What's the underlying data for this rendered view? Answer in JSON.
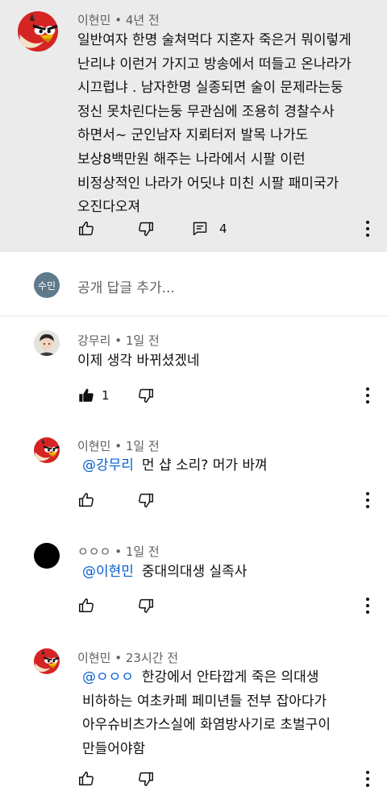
{
  "comment": {
    "author": "이현민",
    "time": "4년 전",
    "lines": [
      "일반여자 한명 술쳐먹다 지혼자 죽은거 뭐이렇게",
      "난리냐 이런거 가지고 방송에서 떠들고 온나라가",
      "시끄럽냐 . 남자한명 실종되면 술이 문제라는둥",
      "정신 못차린다는둥 무관심에 조용히 경찰수사",
      "하면서~ 군인남자 지뢰터저 발목 나가도",
      "보상8백만원 해주는 나라에서 시팔 이런",
      "비정상적인 나라가 어딧냐 미친 시팔 패미국가",
      "오진다오져"
    ],
    "reply_count": "4"
  },
  "reply_box": {
    "avatar_label": "수민",
    "placeholder": "공개 답글 추가..."
  },
  "replies": [
    {
      "author": "강무리",
      "time": "1일 전",
      "mention": "",
      "lines": [
        "이제 생각 바뀌셨겠네"
      ],
      "likes": "1"
    },
    {
      "author": "이현민",
      "time": "1일 전",
      "mention": "@강무리",
      "lines": [
        "먼 샵 소리? 머가 바껴"
      ],
      "likes": ""
    },
    {
      "author": "ㅇㅇㅇ",
      "time": "1일 전",
      "mention": "@이현민",
      "lines": [
        "중대의대생 실족사"
      ],
      "likes": ""
    },
    {
      "author": "이현민",
      "time": "23시간 전",
      "mention": "@ㅇㅇㅇ",
      "lines": [
        "한강에서 안타깝게 죽은 의대생",
        "비하하는 여초카페 페미년들 전부 잡아다가",
        "아우슈비츠가스실에 화염방사기로 초벌구이",
        "만들어야함"
      ],
      "likes": ""
    }
  ],
  "icons": {
    "like": "thumb-up-icon",
    "like_filled": "thumb-up-filled-icon",
    "dislike": "thumb-down-icon",
    "reply": "comment-icon",
    "more": "more-vert-icon"
  },
  "colors": {
    "highlight_bg": "#ebebeb",
    "mention": "#065fd4",
    "meta": "#606060"
  }
}
